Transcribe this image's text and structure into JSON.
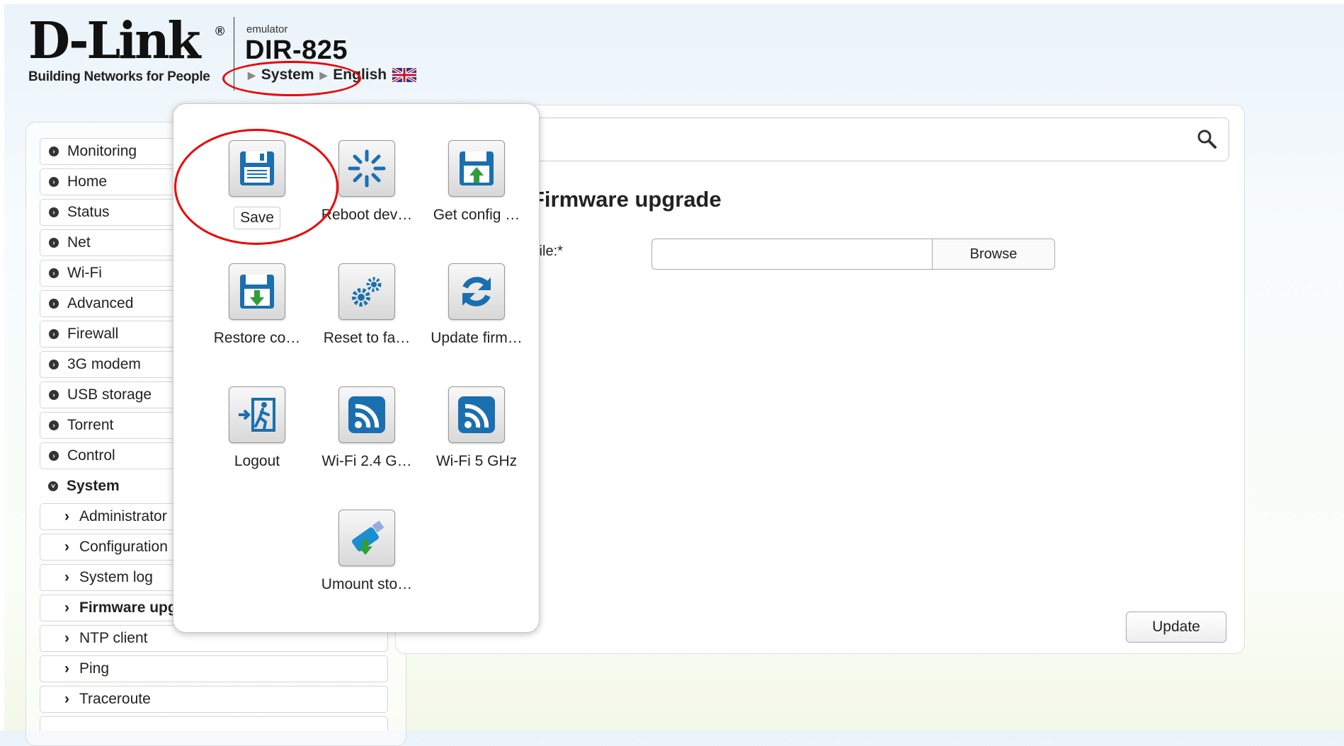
{
  "header": {
    "brand": "D-Link",
    "registered_mark": "®",
    "tagline": "Building Networks for People",
    "emulator_label": "emulator",
    "model": "DIR-825",
    "breadcrumb": [
      "System",
      "English"
    ]
  },
  "sidebar": {
    "items": [
      {
        "label": "Monitoring"
      },
      {
        "label": "Home"
      },
      {
        "label": "Status"
      },
      {
        "label": "Net"
      },
      {
        "label": "Wi-Fi"
      },
      {
        "label": "Advanced"
      },
      {
        "label": "Firewall"
      },
      {
        "label": "3G modem"
      },
      {
        "label": "USB storage"
      },
      {
        "label": "Torrent"
      },
      {
        "label": "Control"
      },
      {
        "label": "System",
        "expanded": true
      }
    ],
    "subitems": [
      {
        "label": "Administrator"
      },
      {
        "label": "Configuration"
      },
      {
        "label": "System log"
      },
      {
        "label": "Firmware upgrade",
        "active": true
      },
      {
        "label": "NTP client"
      },
      {
        "label": "Ping"
      },
      {
        "label": "Traceroute"
      }
    ]
  },
  "main": {
    "title": "Firmware upgrade",
    "file_label": "file:*",
    "browse_label": "Browse",
    "update_label": "Update"
  },
  "popup": {
    "tiles": [
      {
        "label": "Save",
        "icon": "floppy-save-icon"
      },
      {
        "label": "Reboot dev…",
        "icon": "reboot-spinner-icon"
      },
      {
        "label": "Get config …",
        "icon": "floppy-upload-icon"
      },
      {
        "label": "Restore co…",
        "icon": "floppy-download-icon"
      },
      {
        "label": "Reset to fa…",
        "icon": "gears-icon"
      },
      {
        "label": "Update firm…",
        "icon": "refresh-icon"
      },
      {
        "label": "Logout",
        "icon": "exit-icon"
      },
      {
        "label": "Wi-Fi 2.4 G…",
        "icon": "wifi-icon"
      },
      {
        "label": "Wi-Fi 5 GHz",
        "icon": "wifi-icon"
      },
      {
        "label": "Umount sto…",
        "icon": "usb-unmount-icon"
      }
    ]
  },
  "colors": {
    "callout_red": "#e00000",
    "icon_blue": "#1a6fb0",
    "icon_green": "#2f9e3a"
  }
}
